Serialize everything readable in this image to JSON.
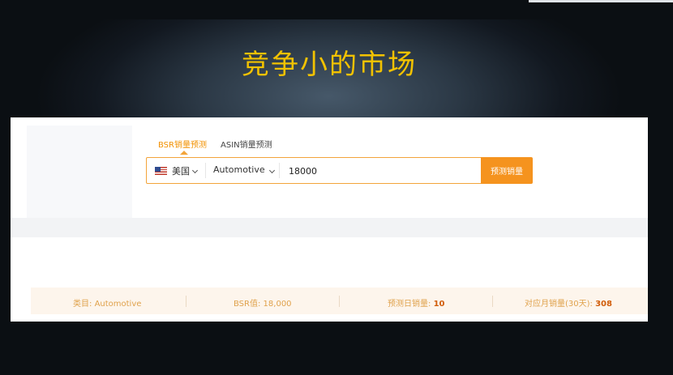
{
  "slide": {
    "title": "竞争小的市场"
  },
  "tabs": [
    {
      "label": "BSR销量预测",
      "active": true
    },
    {
      "label": "ASIN销量预测",
      "active": false
    }
  ],
  "search": {
    "country": "美国",
    "flag_icon": "us-flag-icon",
    "category": "Automotive",
    "bsr_value": "18000",
    "button_label": "预测销量"
  },
  "results": {
    "category_label": "类目:",
    "category_value": "Automotive",
    "bsr_label": "BSR值:",
    "bsr_value": "18,000",
    "daily_label": "预测日销量:",
    "daily_value": "10",
    "monthly_label": "对应月销量(30天):",
    "monthly_value": "308"
  },
  "colors": {
    "accent": "#f5931e",
    "title": "#f2c200",
    "result_value": "#d15d0a"
  }
}
